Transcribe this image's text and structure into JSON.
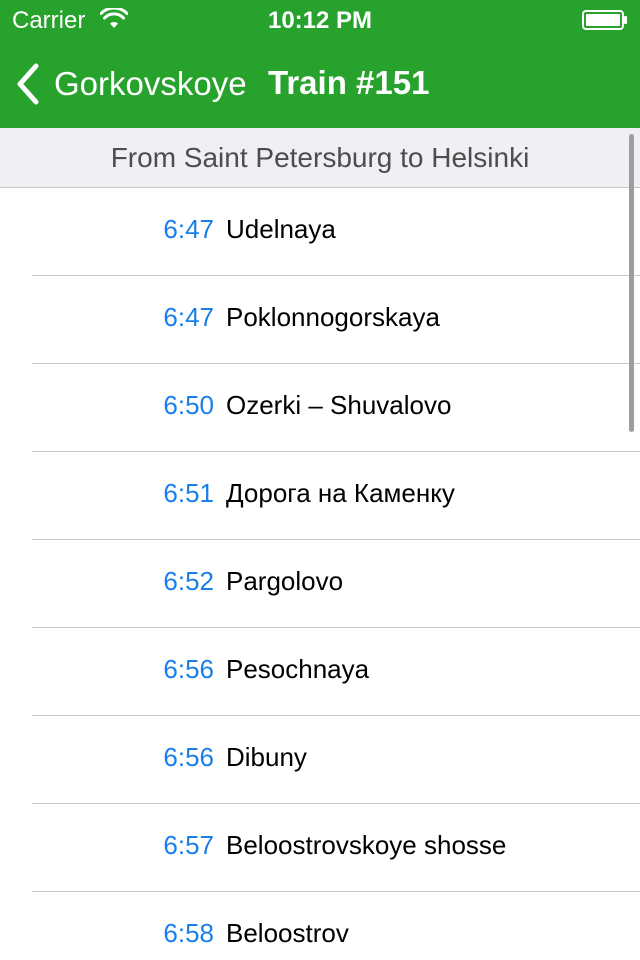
{
  "status_bar": {
    "carrier": "Carrier",
    "time": "10:12 PM",
    "wifi_icon": "wifi-icon",
    "battery_icon": "battery-icon"
  },
  "nav": {
    "back_label": "Gorkovskoye",
    "title": "Train #151",
    "back_icon": "chevron-left-icon",
    "bar_color": "#27a22c"
  },
  "section": {
    "title": "From Saint Petersburg to Helsinki"
  },
  "stops": [
    {
      "time": "6:47",
      "station": "Udelnaya"
    },
    {
      "time": "6:47",
      "station": "Poklonnogorskaya"
    },
    {
      "time": "6:50",
      "station": "Ozerki – Shuvalovo"
    },
    {
      "time": "6:51",
      "station": "Дорога на Каменку"
    },
    {
      "time": "6:52",
      "station": "Pargolovo"
    },
    {
      "time": "6:56",
      "station": "Pesochnaya"
    },
    {
      "time": "6:56",
      "station": "Dibuny"
    },
    {
      "time": "6:57",
      "station": "Beloostrovskoye shosse"
    },
    {
      "time": "6:58",
      "station": "Beloostrov"
    }
  ],
  "colors": {
    "accent_time": "#1a7fe8",
    "separator": "#c8c7cc",
    "section_bg": "#efeff4"
  }
}
